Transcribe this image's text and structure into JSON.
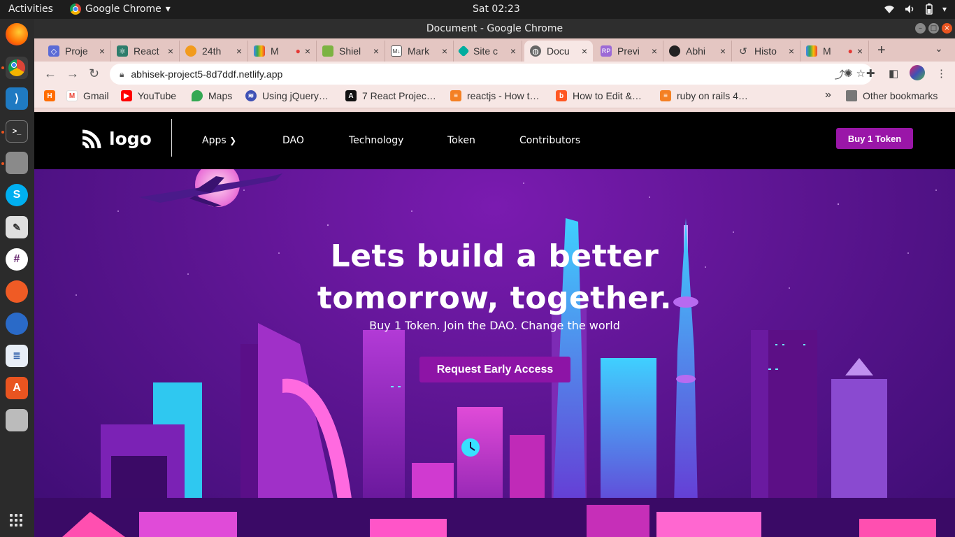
{
  "system": {
    "activities": "Activities",
    "app_name": "Google Chrome",
    "clock": "Sat 02:23"
  },
  "window": {
    "title": "Document - Google Chrome"
  },
  "tabs": [
    {
      "label": "Proje",
      "color": "#5b6bd6"
    },
    {
      "label": "React",
      "color": "#2e7d6b"
    },
    {
      "label": "24th",
      "color": "#f29b1d"
    },
    {
      "label": "M",
      "color": "#34a853"
    },
    {
      "label": "Shiel",
      "color": "#7cb342"
    },
    {
      "label": "Mark",
      "color": "#555555"
    },
    {
      "label": "Site c",
      "color": "#00ad9f"
    },
    {
      "label": "Docu",
      "color": "#666666"
    },
    {
      "label": "Previ",
      "color": "#9c6ad6"
    },
    {
      "label": "Abhi",
      "color": "#222222"
    },
    {
      "label": "Histo",
      "color": "#555555"
    },
    {
      "label": "M",
      "color": "#34a853"
    }
  ],
  "address_bar": {
    "url": "abhisek-project5-8d7ddf.netlify.app"
  },
  "bookmarks": [
    {
      "label": "Gmail",
      "color": "#ea4335"
    },
    {
      "label": "YouTube",
      "color": "#ff0000"
    },
    {
      "label": "Maps",
      "color": "#34a853"
    },
    {
      "label": "Using jQuery…",
      "color": "#3f51b5"
    },
    {
      "label": "7 React Projec…",
      "color": "#111111"
    },
    {
      "label": "reactjs - How t…",
      "color": "#f48024"
    },
    {
      "label": "How to Edit &…",
      "color": "#ff5722"
    },
    {
      "label": "ruby on rails 4…",
      "color": "#f48024"
    }
  ],
  "bookmarks_overflow": "»",
  "other_bookmarks": "Other bookmarks",
  "site": {
    "logo_text": "logo",
    "nav": [
      "Apps",
      "DAO",
      "Technology",
      "Token",
      "Contributors"
    ],
    "buy_button": "Buy 1 Token",
    "hero_title_line1": "Lets build a better",
    "hero_title_line2": "tomorrow, together.",
    "hero_subtitle": "Buy 1 Token. Join the DAO. Change the world",
    "cta": "Request Early Access",
    "accent": "#9a16a8"
  }
}
